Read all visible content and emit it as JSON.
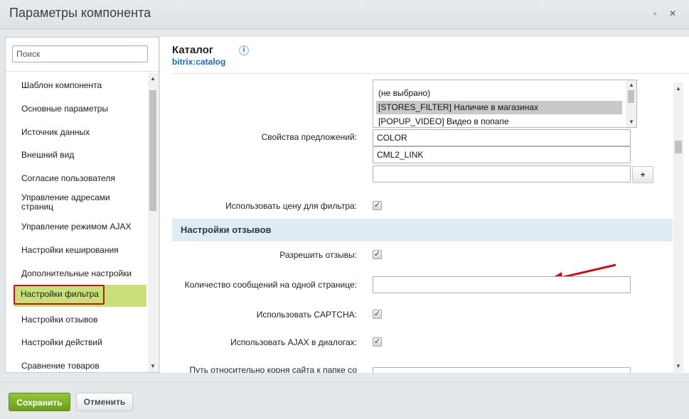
{
  "window": {
    "title": "Параметры компонента",
    "maximize_glyph": "▫",
    "close_glyph": "✕"
  },
  "sidebar": {
    "search_placeholder": "Поиск",
    "items": [
      {
        "label": "Шаблон компонента"
      },
      {
        "label": "Основные параметры"
      },
      {
        "label": "Источник данных"
      },
      {
        "label": "Внешний вид"
      },
      {
        "label": "Согласие пользователя"
      },
      {
        "label": "Управление адресами страниц"
      },
      {
        "label": "Управление режимом AJAX"
      },
      {
        "label": "Настройки кеширования"
      },
      {
        "label": "Дополнительные настройки"
      },
      {
        "label": "Настройки фильтра",
        "active": true
      },
      {
        "label": "Настройки отзывов"
      },
      {
        "label": "Настройки действий"
      },
      {
        "label": "Сравнение товаров"
      }
    ]
  },
  "component": {
    "name": "Каталог",
    "code": "bitrix:catalog",
    "info_glyph": "i"
  },
  "form": {
    "offer_props_label": "Свойства предложений:",
    "offer_props_options": [
      {
        "label": "(не выбрано)",
        "selected": false
      },
      {
        "label": "[STORES_FILTER] Наличие в магазинах",
        "selected": true
      },
      {
        "label": "[POPUP_VIDEO] Видео в попапе",
        "selected": false
      }
    ],
    "offer_props_values": [
      "COLOR",
      "CML2_LINK",
      ""
    ],
    "add_button_label": "+",
    "use_price_filter_label": "Использовать цену для фильтра:",
    "use_price_filter_checked": true,
    "reviews_section_title": "Настройки отзывов",
    "allow_reviews_label": "Разрешить отзывы:",
    "allow_reviews_checked": true,
    "messages_per_page_label": "Количество сообщений на одной странице:",
    "messages_per_page_value": "",
    "use_captcha_label": "Использовать CAPTCHA:",
    "use_captcha_checked": true,
    "use_ajax_dialogs_label": "Использовать AJAX в диалогах:",
    "use_ajax_dialogs_checked": true,
    "path_label_partial": "Путь относительно корня сайта к папке со"
  },
  "footer": {
    "save_label": "Сохранить",
    "cancel_label": "Отменить"
  },
  "colors": {
    "accent_green": "#7cb22a",
    "active_item_bg": "#c9e07a",
    "highlight_red": "#c0141a",
    "section_bg": "#e0ebf4",
    "link_blue": "#2067b0"
  }
}
